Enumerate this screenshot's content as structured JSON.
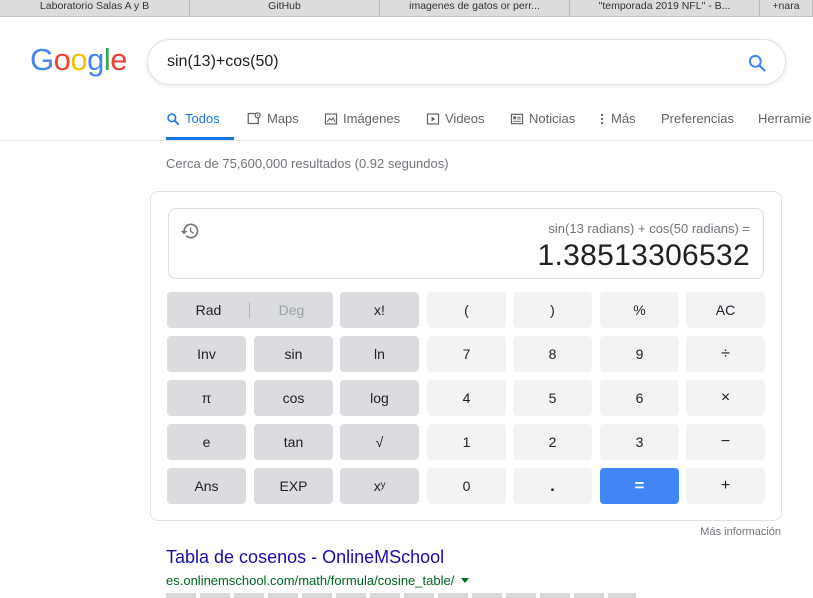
{
  "browser_tabs": [
    "Laboratorio Salas A y B",
    "GitHub",
    "imagenes de gatos or perr...",
    "\"temporada 2019 NFL\" - B...",
    "+nara"
  ],
  "logo": {
    "letters": [
      "G",
      "o",
      "o",
      "g",
      "l",
      "e"
    ],
    "colors": [
      "#4285f4",
      "#ea4335",
      "#fbbc05",
      "#4285f4",
      "#34a853",
      "#ea4335"
    ]
  },
  "search": {
    "query": "sin(13)+cos(50)",
    "icon": "search-icon"
  },
  "nav": {
    "items": [
      {
        "label": "Todos",
        "icon": "search-icon",
        "active": true
      },
      {
        "label": "Maps",
        "icon": "map-pin-icon"
      },
      {
        "label": "Imágenes",
        "icon": "image-icon"
      },
      {
        "label": "Videos",
        "icon": "play-icon"
      },
      {
        "label": "Noticias",
        "icon": "news-icon"
      },
      {
        "label": "Más",
        "icon": "more-vert-icon"
      },
      {
        "label": "Preferencias"
      },
      {
        "label": "Herramie"
      }
    ],
    "accent": "#1a73e8"
  },
  "result_stats": "Cerca de 75,600,000 resultados (0.92 segundos)",
  "calculator": {
    "expression": "sin(13 radians) + cos(50 radians) =",
    "result": "1.38513306532",
    "rad_label": "Rad",
    "deg_label": "Deg",
    "rows": [
      [
        "x!",
        "(",
        ")",
        "%",
        "AC"
      ],
      [
        "Inv",
        "sin",
        "ln",
        "7",
        "8",
        "9",
        "÷"
      ],
      [
        "π",
        "cos",
        "log",
        "4",
        "5",
        "6",
        "×"
      ],
      [
        "e",
        "tan",
        "√",
        "1",
        "2",
        "3",
        "−"
      ],
      [
        "Ans",
        "EXP",
        "xʸ",
        "0",
        ".",
        "=",
        "+"
      ]
    ],
    "equals_color": "#4285f4"
  },
  "more_info": "Más información",
  "first_result": {
    "title": "Tabla de cosenos - OnlineMSchool",
    "url": "es.onlinemschool.com/math/formula/cosine_table/"
  }
}
